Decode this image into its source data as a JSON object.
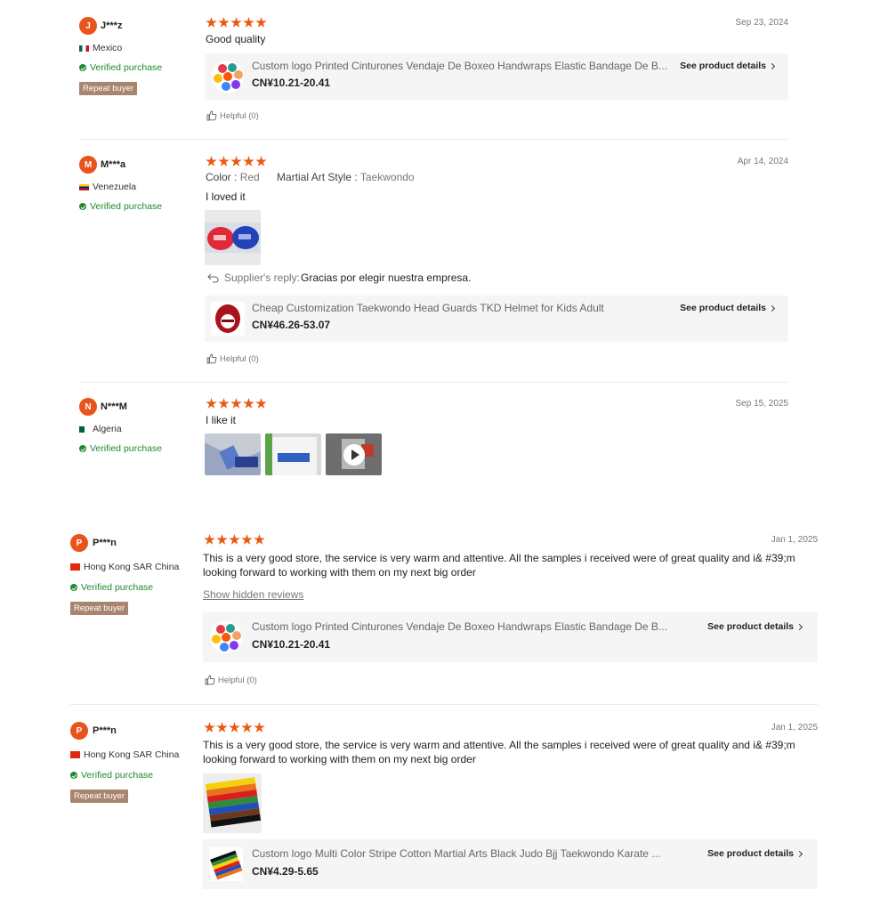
{
  "reviews": [
    {
      "initial": "J",
      "user": "J***z",
      "country": "Mexico",
      "verified": "Verified purchase",
      "badge": "Repeat buyer",
      "rating": 5,
      "date": "Sep 23, 2024",
      "text": "Good quality",
      "product": {
        "title": "Custom logo Printed Cinturones Vendaje De Boxeo Handwraps Elastic Bandage De B...",
        "price": "CN¥10.21-20.41",
        "details": "See product details"
      },
      "helpful": "Helpful (0)"
    },
    {
      "initial": "M",
      "user": "M***a",
      "country": "Venezuela",
      "verified": "Verified purchase",
      "rating": 5,
      "date": "Apr 14, 2024",
      "attrs": {
        "color_label": "Color :",
        "color_value": "Red",
        "style_label": "Martial Art Style :",
        "style_value": "Taekwondo"
      },
      "text": "I loved it",
      "reply_label": "Supplier's reply:",
      "reply_text": "Gracias por elegir nuestra empresa.",
      "product": {
        "title": "Cheap Customization Taekwondo Head Guards TKD Helmet for Kids Adult",
        "price": "CN¥46.26-53.07",
        "details": "See product details"
      },
      "helpful": "Helpful (0)"
    },
    {
      "initial": "N",
      "user": "N***M",
      "country": "Algeria",
      "verified": "Verified purchase",
      "rating": 5,
      "date": "Sep 15, 2025",
      "text": "I like it"
    },
    {
      "initial": "P",
      "user": "P***n",
      "country": "Hong Kong SAR China",
      "verified": "Verified purchase",
      "badge": "Repeat buyer",
      "rating": 5,
      "date": "Jan 1, 2025",
      "text": "This is a very good store, the service is very warm and attentive. All the samples i received were of great quality and i& #39;m looking forward to working with them on my next big order",
      "show_hidden": "Show hidden reviews",
      "product": {
        "title": "Custom logo Printed Cinturones Vendaje De Boxeo Handwraps Elastic Bandage De B...",
        "price": "CN¥10.21-20.41",
        "details": "See product details"
      },
      "helpful": "Helpful (0)"
    },
    {
      "initial": "P",
      "user": "P***n",
      "country": "Hong Kong SAR China",
      "verified": "Verified purchase",
      "badge": "Repeat buyer",
      "rating": 5,
      "date": "Jan 1, 2025",
      "text": "This is a very good store, the service is very warm and attentive. All the samples i received were of great quality and i& #39;m looking forward to working with them on my next big order",
      "product": {
        "title": "Custom logo Multi Color Stripe Cotton Martial Arts Black Judo Bjj Taekwondo Karate ...",
        "price": "CN¥4.29-5.65",
        "details": "See product details"
      }
    }
  ],
  "colors": {
    "accent": "#ea5a14",
    "verified": "#1f8a2e",
    "repeat_badge": "#a9846e"
  }
}
